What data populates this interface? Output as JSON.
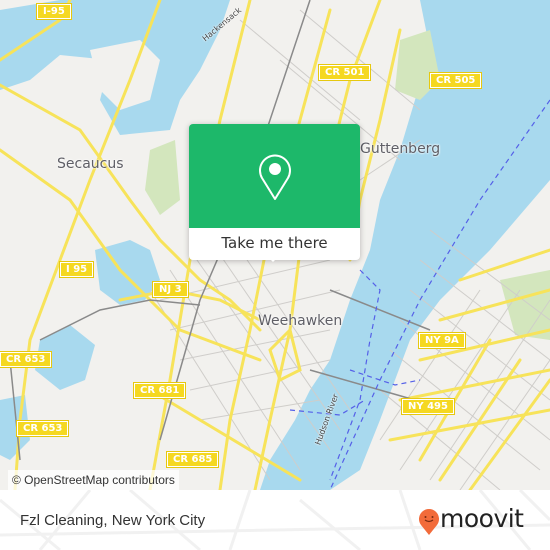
{
  "map": {
    "colors": {
      "water": "#a8d9ee",
      "land": "#f2f1ee",
      "road": "#f7e35a",
      "park": "#d3e6bd",
      "rail": "#8a8a8a",
      "ferry": "#5560e8"
    },
    "place_labels": [
      "Secaucus",
      "Guttenberg",
      "Weehawken"
    ],
    "road_shields": [
      "I-95",
      "CR 501",
      "CR 505",
      "I 95",
      "NJ 3",
      "CR 653",
      "CR 653",
      "CR 681",
      "CR 685",
      "NY 9A",
      "NY 495"
    ],
    "water_labels": [
      "Hackensack",
      "Hudson River"
    ],
    "attribution": "© OpenStreetMap contributors"
  },
  "popup": {
    "icon": "map-pin-icon",
    "button_label": "Take me there",
    "accent_color": "#1db86a"
  },
  "footer": {
    "title": "Fzl Cleaning, New York City",
    "brand": "moovit",
    "brand_color": "#f26b3a"
  }
}
